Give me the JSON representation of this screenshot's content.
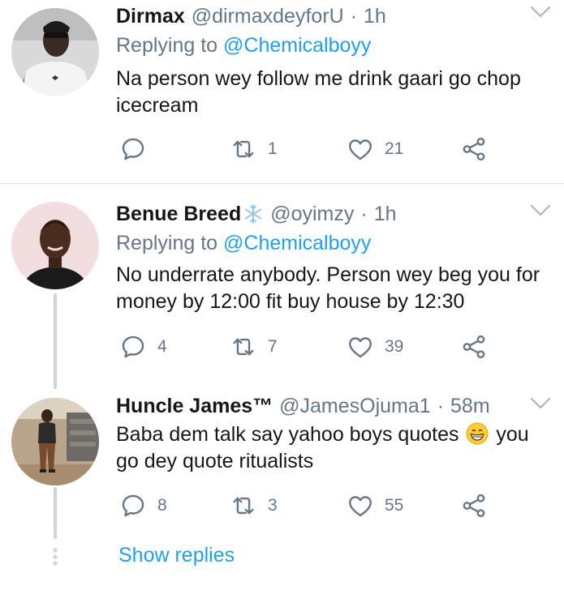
{
  "colors": {
    "text": "#14171a",
    "muted": "#657786",
    "link": "#1da1f2",
    "divider": "#e1e8ed",
    "thread_line": "#ccd6dd"
  },
  "tweets": [
    {
      "name": "Dirmax",
      "handle": "@dirmaxdeyforU",
      "dot": "·",
      "time": "1h",
      "replying_prefix": "Replying to",
      "replying_to": "@Chemicalboyy",
      "text": "Na person wey follow me drink gaari go chop icecream",
      "reply_count": "",
      "retweet_count": "1",
      "like_count": "21"
    },
    {
      "name": "Benue Breed",
      "name_icon": "snowflake-icon",
      "handle": "@oyimzy",
      "dot": "·",
      "time": "1h",
      "replying_prefix": "Replying to",
      "replying_to": "@Chemicalboyy",
      "text": "No underrate anybody. Person wey beg you for money by 12:00 fit buy house by 12:30",
      "reply_count": "4",
      "retweet_count": "7",
      "like_count": "39"
    },
    {
      "name": "Huncle James™",
      "handle": "@JamesOjuma1",
      "dot": "·",
      "time": "58m",
      "text_before_emoji": "Baba dem talk say yahoo boys quotes",
      "emoji": "grinning-face-emoji",
      "text_after_emoji": "you go dey quote ritualists",
      "reply_count": "8",
      "retweet_count": "3",
      "like_count": "55"
    }
  ],
  "show_replies": "Show replies"
}
